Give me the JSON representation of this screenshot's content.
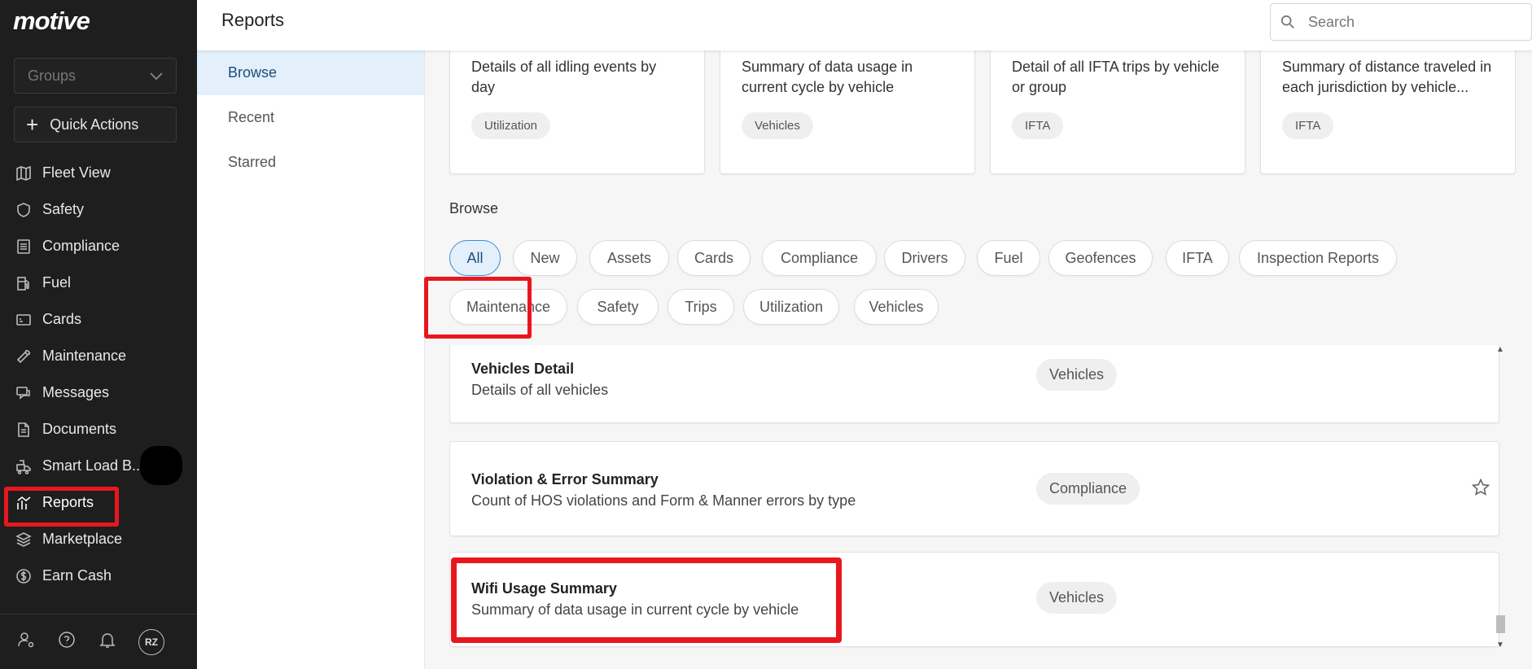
{
  "sidebar": {
    "logo": "motive",
    "groups_placeholder": "Groups",
    "quick_actions": "Quick Actions",
    "items": [
      {
        "label": "Fleet View",
        "icon": "map-icon"
      },
      {
        "label": "Safety",
        "icon": "shield-icon"
      },
      {
        "label": "Compliance",
        "icon": "document-list-icon"
      },
      {
        "label": "Fuel",
        "icon": "fuel-pump-icon"
      },
      {
        "label": "Cards",
        "icon": "card-icon"
      },
      {
        "label": "Maintenance",
        "icon": "wrench-icon"
      },
      {
        "label": "Messages",
        "icon": "messages-icon"
      },
      {
        "label": "Documents",
        "icon": "document-icon"
      },
      {
        "label": "Smart Load B...",
        "icon": "truck-load-icon"
      },
      {
        "label": "Reports",
        "icon": "chart-icon"
      },
      {
        "label": "Marketplace",
        "icon": "layers-icon"
      },
      {
        "label": "Earn Cash",
        "icon": "dollar-icon"
      }
    ],
    "avatar_initials": "RZ"
  },
  "header": {
    "title": "Reports",
    "search_placeholder": "Search"
  },
  "subnav": [
    "Browse",
    "Recent",
    "Starred"
  ],
  "cards": [
    {
      "desc": "Details of all idling events by day",
      "tag": "Utilization"
    },
    {
      "desc": "Summary of data usage in current cycle by vehicle",
      "tag": "Vehicles"
    },
    {
      "desc": "Detail of all IFTA trips by vehicle or group",
      "tag": "IFTA"
    },
    {
      "desc": "Summary of distance traveled in each jurisdiction by vehicle...",
      "tag": "IFTA"
    }
  ],
  "browse": {
    "label": "Browse",
    "chips": [
      "All",
      "New",
      "Assets",
      "Cards",
      "Compliance",
      "Drivers",
      "Fuel",
      "Geofences",
      "IFTA",
      "Inspection Reports",
      "Maintenance",
      "Safety",
      "Trips",
      "Utilization",
      "Vehicles"
    ],
    "active_chip": "All"
  },
  "reports": [
    {
      "title": "Vehicles Detail",
      "desc": "Details of all vehicles",
      "tag": "Vehicles"
    },
    {
      "title": "Violation & Error Summary",
      "desc": "Count of HOS violations and Form & Manner errors by type",
      "tag": "Compliance"
    },
    {
      "title": "Wifi Usage Summary",
      "desc": "Summary of data usage in current cycle by vehicle",
      "tag": "Vehicles"
    }
  ],
  "colors": {
    "sidebar_bg": "#1e1e1e",
    "accent": "#3a8fd6",
    "highlight": "#e8171e"
  }
}
